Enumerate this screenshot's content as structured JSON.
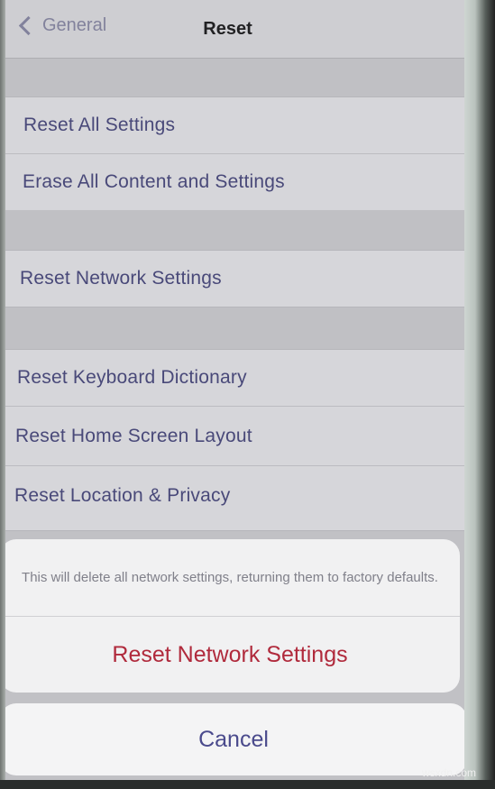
{
  "nav": {
    "back_label": "General",
    "title": "Reset"
  },
  "groups": [
    {
      "items": [
        {
          "label": "Reset All Settings"
        },
        {
          "label": "Erase All Content and Settings"
        }
      ]
    },
    {
      "items": [
        {
          "label": "Reset Network Settings"
        }
      ]
    },
    {
      "items": [
        {
          "label": "Reset Keyboard Dictionary"
        },
        {
          "label": "Reset Home Screen Layout"
        },
        {
          "label": "Reset Location & Privacy"
        }
      ]
    }
  ],
  "action_sheet": {
    "message": "This will delete all network settings, returning them to factory defaults.",
    "destructive_label": "Reset Network Settings",
    "cancel_label": "Cancel"
  },
  "watermark": "wsxdn.com",
  "colors": {
    "link": "#4c4c80",
    "destructive": "#b02a3c",
    "cancel": "#4a4a8c"
  }
}
